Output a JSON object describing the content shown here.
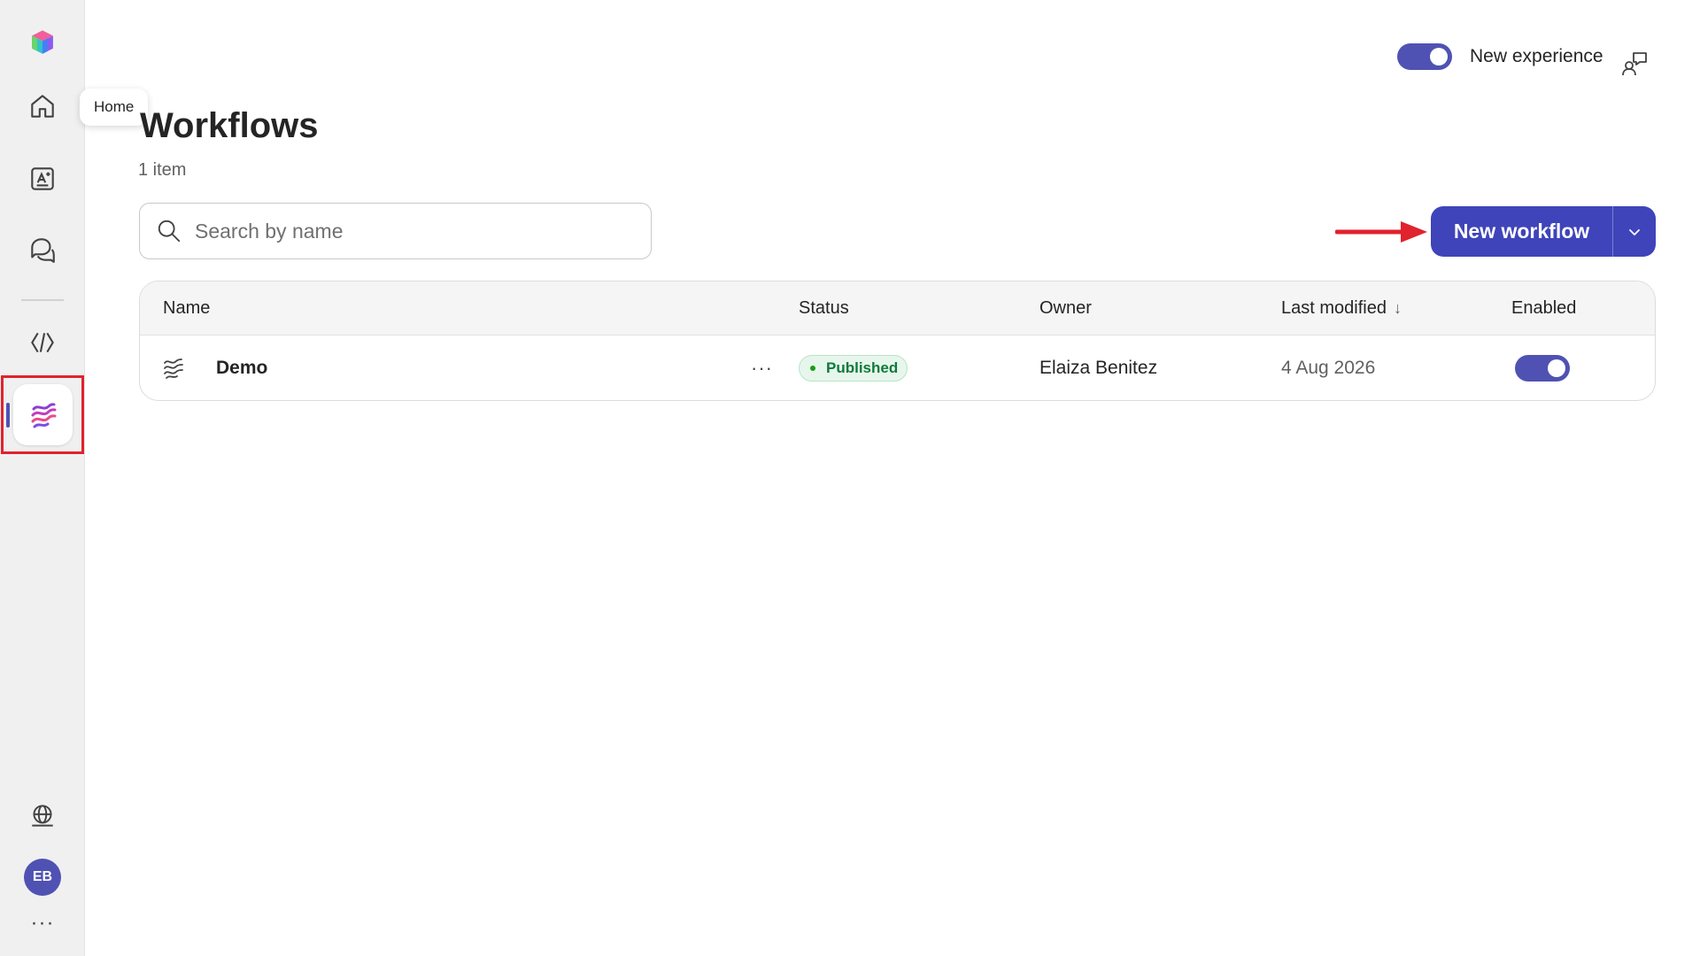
{
  "tooltip": {
    "text": "Home"
  },
  "header": {
    "new_experience_label": "New experience",
    "new_experience_on": true
  },
  "page": {
    "title": "Workflows",
    "item_count": "1 item"
  },
  "search": {
    "placeholder": "Search by name"
  },
  "actions": {
    "new_workflow_label": "New workflow"
  },
  "table": {
    "columns": {
      "name": "Name",
      "status": "Status",
      "owner": "Owner",
      "last_modified": "Last modified",
      "enabled": "Enabled"
    },
    "sort_indicator": "↓",
    "rows": [
      {
        "name": "Demo",
        "more": "···",
        "status": "Published",
        "owner": "Elaiza Benitez",
        "last_modified": "4 Aug 2026",
        "enabled": true
      }
    ]
  },
  "user": {
    "initials": "EB"
  },
  "rail": {
    "more": "···"
  },
  "colors": {
    "accent": "#4f52b2",
    "button": "#3f44ba",
    "highlight": "#e0232e",
    "published_text": "#0e7a3a"
  }
}
